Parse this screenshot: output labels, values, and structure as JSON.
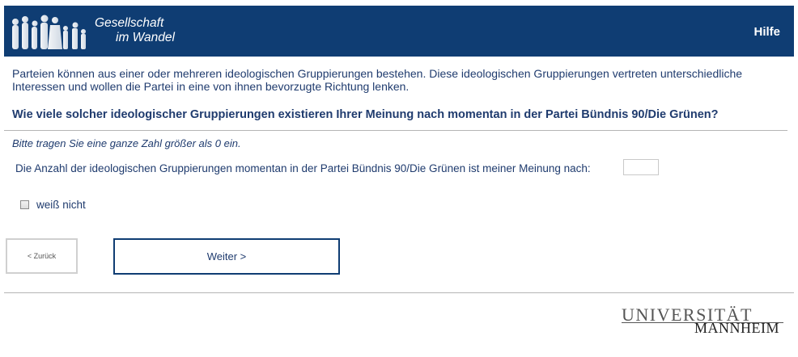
{
  "header": {
    "logo_line1": "Gesellschaft",
    "logo_line2": "im Wandel",
    "help_label": "Hilfe"
  },
  "intro_text": "Parteien können aus einer oder mehreren ideologischen Gruppierungen bestehen. Diese ideologischen Gruppierungen vertreten unterschiedliche Interessen und wollen die Partei in eine von ihnen bevorzugte Richtung lenken.",
  "question": "Wie viele solcher ideologischer Gruppierungen existieren Ihrer Meinung nach momentan in der Partei Bündnis 90/Die Grünen?",
  "hint": "Bitte tragen Sie eine ganze Zahl größer als 0 ein.",
  "field_label": "Die Anzahl der ideologischen Gruppierungen momentan in der Partei Bündnis 90/Die Grünen ist meiner Meinung nach:",
  "field_value": "",
  "dont_know_label": "weiß nicht",
  "buttons": {
    "back_label": "< Zurück",
    "next_label": "Weiter >"
  },
  "footer": {
    "uni_line1": "UNIVERSITÄT",
    "uni_line2": "MANNHEIM"
  }
}
